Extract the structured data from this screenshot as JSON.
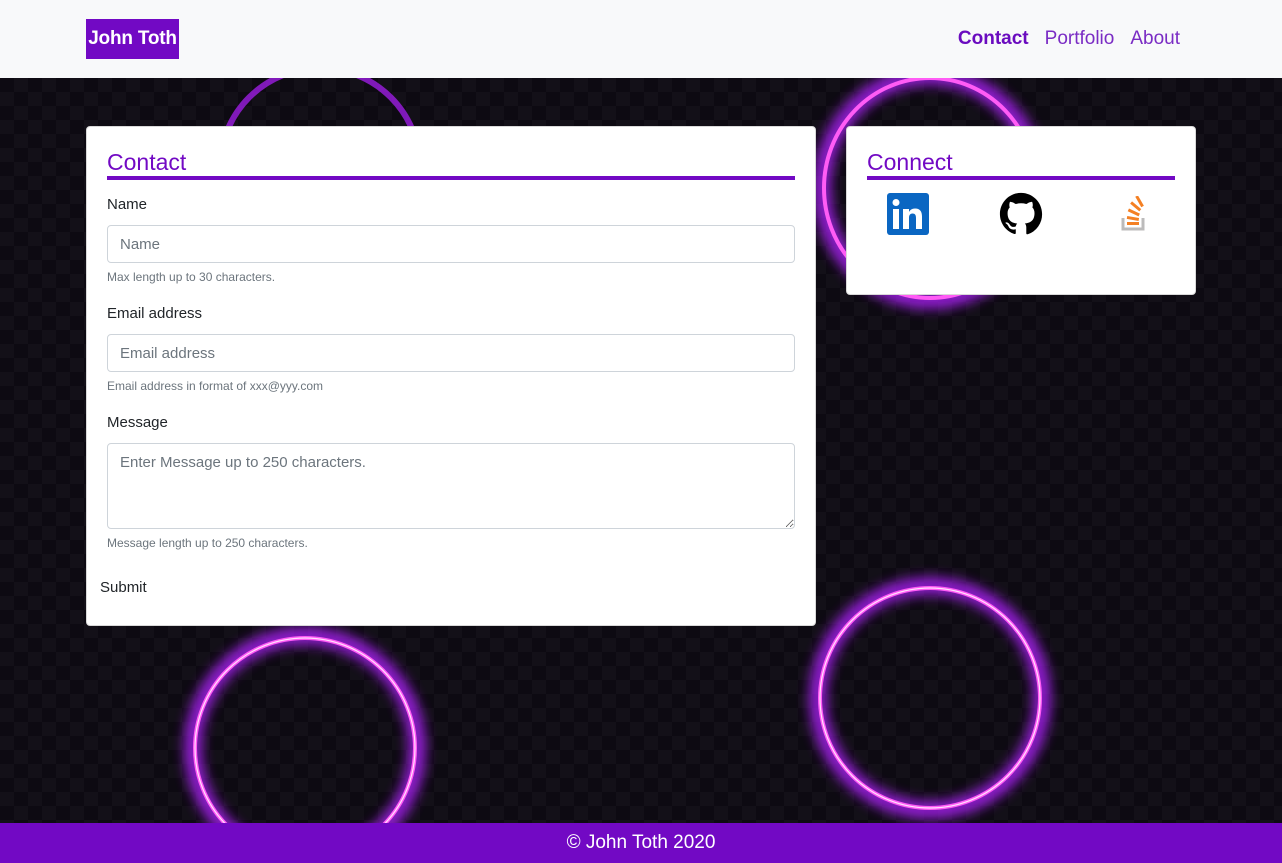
{
  "brand": {
    "name": "John Toth"
  },
  "nav": {
    "contact": "Contact",
    "portfolio": "Portfolio",
    "about": "About"
  },
  "contact": {
    "title": "Contact",
    "name_label": "Name",
    "name_placeholder": "Name",
    "name_help": "Max length up to 30 characters.",
    "email_label": "Email address",
    "email_placeholder": "Email address",
    "email_help": "Email address in format of xxx@yyy.com",
    "message_label": "Message",
    "message_placeholder": "Enter Message up to 250 characters.",
    "message_help": "Message length up to 250 characters.",
    "submit_label": "Submit"
  },
  "connect": {
    "title": "Connect",
    "icons": [
      "linkedin-icon",
      "github-icon",
      "stackoverflow-icon"
    ]
  },
  "footer": {
    "text": "© John Toth 2020"
  },
  "colors": {
    "accent": "#7209c4",
    "navbar_bg": "#f8f9fa",
    "page_bg": "#0d0a12"
  }
}
